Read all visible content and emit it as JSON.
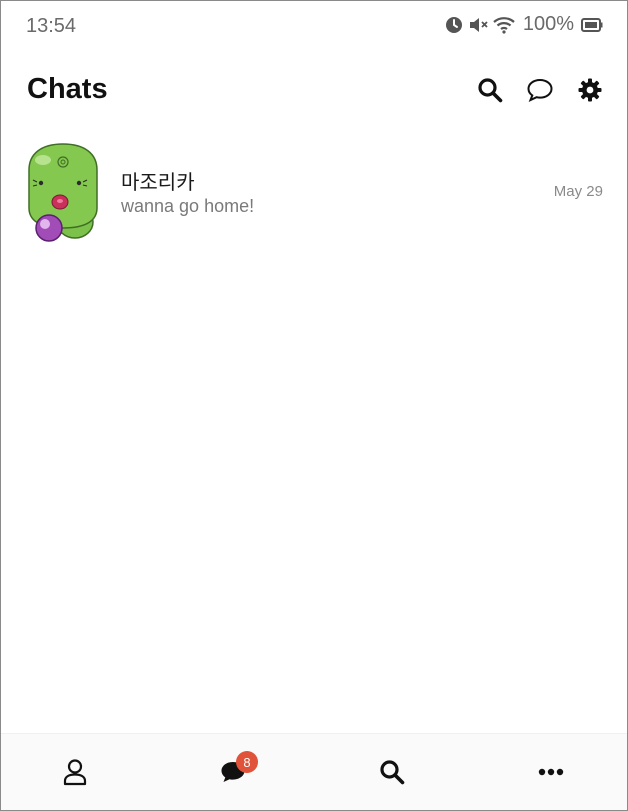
{
  "status_bar": {
    "time": "13:54",
    "battery": "100%",
    "icons": [
      "alarm-icon",
      "mute-icon",
      "wifi-icon",
      "battery-icon"
    ]
  },
  "header": {
    "title": "Chats",
    "actions": [
      "search-icon",
      "new-chat-icon",
      "settings-icon"
    ]
  },
  "chats": [
    {
      "name": "마조리카",
      "preview": "wanna go home!",
      "date": "May 29",
      "avatar": "green-creature-avatar"
    }
  ],
  "bottom_nav": {
    "items": [
      "friends-icon",
      "chats-icon",
      "search-icon",
      "more-icon"
    ],
    "chats_badge": "8"
  },
  "colors": {
    "badge": "#e0523a",
    "avatar_green": "#7cc24a",
    "title": "#111111",
    "secondary_text": "#7a7a7a"
  }
}
